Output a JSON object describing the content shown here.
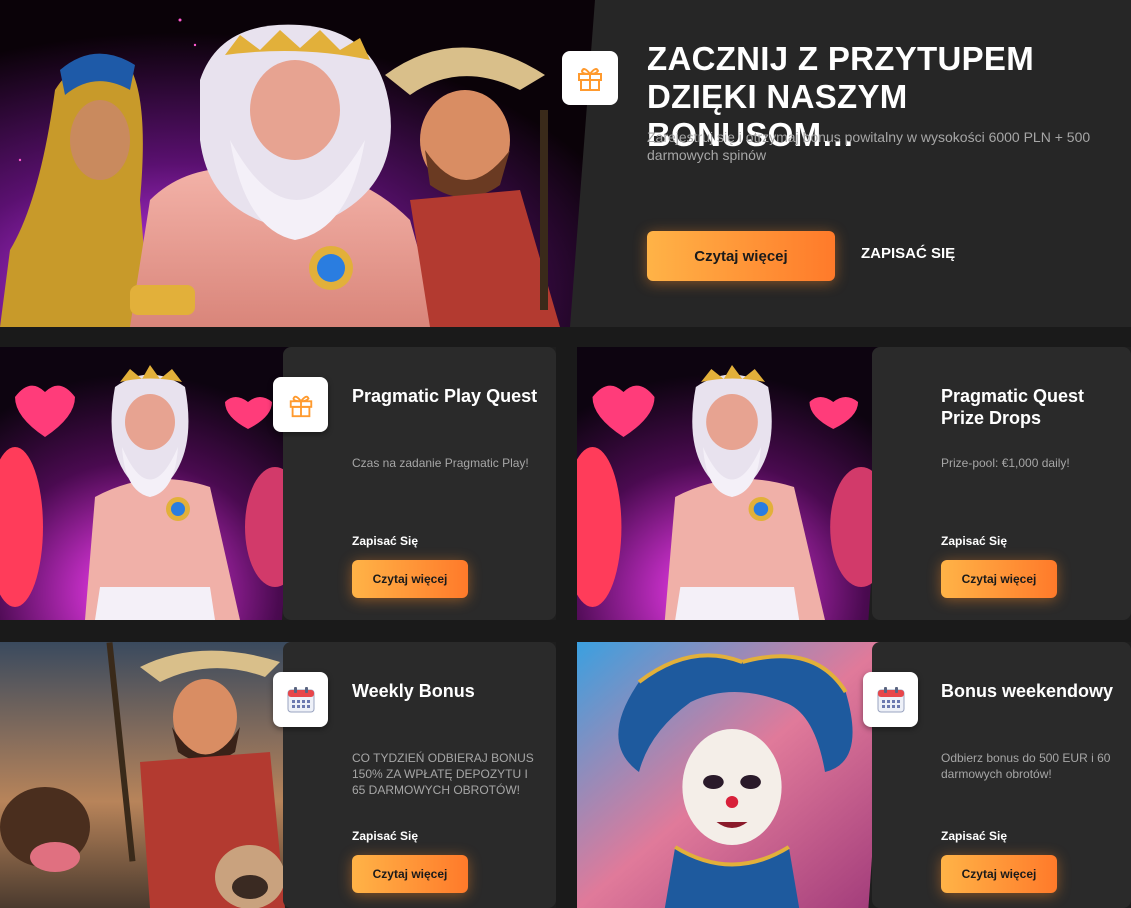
{
  "hero": {
    "title_line1": "ZACZNIJ Z PRZYTUPEM",
    "title_line2": "DZIĘKI NASZYM BONUSOM…",
    "subtitle": "Zarejestruj się i otrzymaj bonus powitalny w wysokości 6000 PLN + 500 darmowych spinów",
    "read_more": "Czytaj więcej",
    "signup": "ZAPISAĆ SIĘ",
    "icon": "gift-icon"
  },
  "cards": [
    {
      "title": "Pragmatic Play Quest",
      "description": "Czas na zadanie Pragmatic Play!",
      "signup": "Zapisać Się",
      "read_more": "Czytaj więcej",
      "icon": "gift-icon"
    },
    {
      "title": "Pragmatic Quest Prize Drops",
      "description": "Prize-pool: €1,000 daily!",
      "signup": "Zapisać Się",
      "read_more": "Czytaj więcej",
      "icon": null
    },
    {
      "title": "Weekly Bonus",
      "description": "CO TYDZIEŃ ODBIERAJ BONUS 150% ZA WPŁATĘ DEPOZYTU I 65 DARMOWYCH OBROTÓW!",
      "signup": "Zapisać Się",
      "read_more": "Czytaj więcej",
      "icon": "calendar-icon"
    },
    {
      "title": "Bonus weekendowy",
      "description": "Odbierz bonus do 500 EUR i 60 darmowych obrotów!",
      "signup": "Zapisać Się",
      "read_more": "Czytaj więcej",
      "icon": "calendar-icon"
    }
  ],
  "colors": {
    "accent_start": "#ffb347",
    "accent_end": "#ff7a2a",
    "icon_orange": "#ff9a2e",
    "background": "#1a1a1a",
    "panel": "#2a2a2a"
  }
}
